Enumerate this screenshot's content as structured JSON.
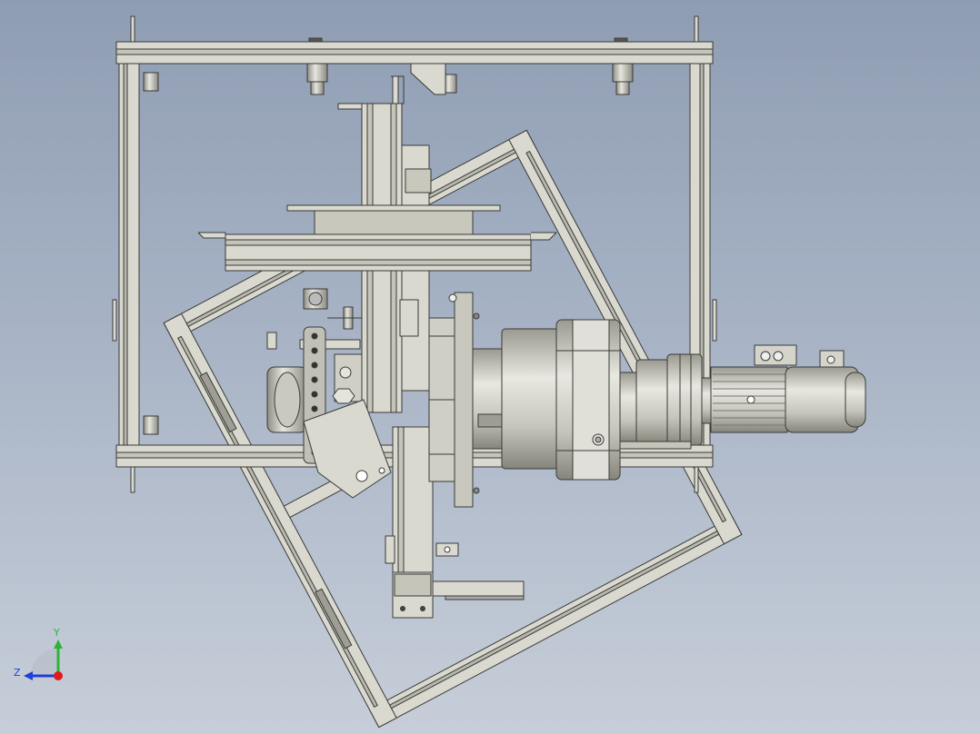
{
  "viewport": {
    "background_top": "#8f9db3",
    "background_bottom": "#c7ced9",
    "part_fill": "#d9d9cf",
    "part_fill_dark": "#b8b8ad",
    "edge_color": "#3a3a3a"
  },
  "triad": {
    "y_label": "Y",
    "z_label": "Z",
    "y_color": "#2db33a",
    "z_color": "#1f3fd6",
    "x_color": "#e01a1a"
  }
}
